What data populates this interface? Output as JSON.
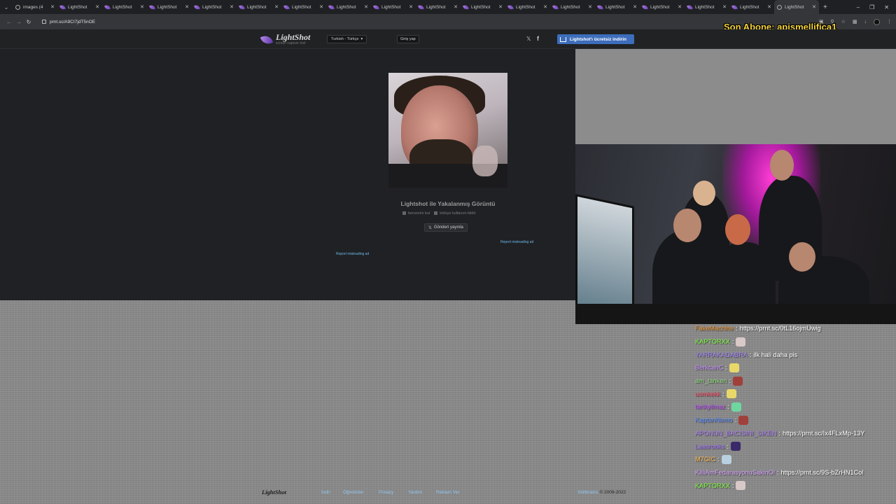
{
  "browser": {
    "tabs": [
      {
        "title": "images (4",
        "icon": "globe",
        "active": false
      },
      {
        "title": "LightShot",
        "icon": "feather",
        "active": false
      },
      {
        "title": "LightShot",
        "icon": "feather",
        "active": false
      },
      {
        "title": "LightShot",
        "icon": "feather",
        "active": false
      },
      {
        "title": "LightShot",
        "icon": "feather",
        "active": false
      },
      {
        "title": "LightShot",
        "icon": "feather",
        "active": false
      },
      {
        "title": "LightShot",
        "icon": "feather",
        "active": false
      },
      {
        "title": "LightShot",
        "icon": "feather",
        "active": false
      },
      {
        "title": "LightShot",
        "icon": "feather",
        "active": false
      },
      {
        "title": "LightShot",
        "icon": "feather",
        "active": false
      },
      {
        "title": "LightShot",
        "icon": "feather",
        "active": false
      },
      {
        "title": "LightShot",
        "icon": "feather",
        "active": false
      },
      {
        "title": "LightShot",
        "icon": "feather",
        "active": false
      },
      {
        "title": "LightShot",
        "icon": "feather",
        "active": false
      },
      {
        "title": "LightShot",
        "icon": "feather",
        "active": false
      },
      {
        "title": "LightShot",
        "icon": "feather",
        "active": false
      },
      {
        "title": "LightShot",
        "icon": "feather",
        "active": false
      },
      {
        "title": "LightShot",
        "icon": "globe",
        "active": true
      }
    ],
    "url": "prnt.sc/A9CI7jdT5nOE"
  },
  "overlay": {
    "subscriber": "Son Abone: apismellifica1"
  },
  "lightshot": {
    "logo_text": "LightShot",
    "logo_sub": "screen capture tool",
    "language": "Turkish - Türkçe",
    "login": "Giriş yap",
    "download": "Lightshot'ı ücretsiz indirin",
    "caption_title": "Lightshot ile Yakalanmış Görüntü",
    "similar": "benzerini bul",
    "report_abuse": "kötüye kullanım bildir",
    "tweet": "Gönderi yayınla",
    "report_ad": "Report misleading ad"
  },
  "footer": {
    "logo": "LightShot",
    "links": [
      "İndir",
      "Öğreticiler",
      "Privacy",
      "Yardım",
      "Reklam Ver"
    ],
    "brand": "Skillbrains",
    "copyright": "© 2009-2022"
  },
  "chat": [
    {
      "user": "FakeMachine",
      "color": "#e8912e",
      "msg": "https://prnt.sc/0tL16ojmUwig"
    },
    {
      "user": "KAPTORXX",
      "color": "#7cff3a",
      "emote_color": "#d8c8c8"
    },
    {
      "user": "YARRAKADABRA",
      "color": "#a486ff",
      "msg": "ilk hali daha pis"
    },
    {
      "user": "BerkcanC",
      "color": "#c890ff",
      "emote_color": "#e8d86a"
    },
    {
      "user": "am_tankeri",
      "color": "#8fdc7a",
      "emote_color": "#a0403a"
    },
    {
      "user": "usmkekk",
      "color": "#ff4d6a",
      "emote_color": "#e8d86a"
    },
    {
      "user": "tarikyilmaz",
      "color": "#c050ff",
      "emote_color": "#6fd6a0"
    },
    {
      "user": "KaptanNemo",
      "color": "#5a8dff",
      "emote_color": "#a0403a"
    },
    {
      "user": "APONUN_BACISINI_SIKEN",
      "color": "#b080ff",
      "msg": "https://prnt.sc/Ix4FLxMp-13Y"
    },
    {
      "user": "Laasrooks",
      "color": "#a070ff",
      "emote_color": "#3a2a6a"
    },
    {
      "user": "M7GIC",
      "color": "#ffb84a",
      "emote_color": "#b8d0e0"
    },
    {
      "user": "KilliAmFedarasyonuSakinOl",
      "color": "#d9a4ff",
      "msg": "https://prnt.sc/9S-bZrHN1Col"
    },
    {
      "user": "KAPTORXX",
      "color": "#7cff3a",
      "emote_color": "#d8c8c8"
    }
  ]
}
